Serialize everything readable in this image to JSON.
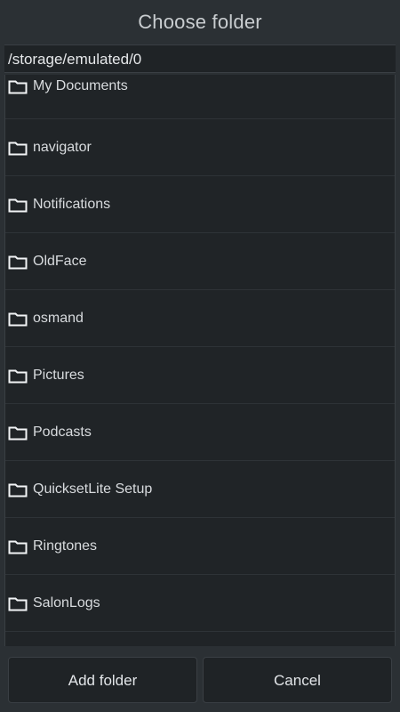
{
  "dialog": {
    "title": "Choose folder",
    "path": "/storage/emulated/0",
    "folders": [
      {
        "name": "My Documents",
        "icon": "folder-icon"
      },
      {
        "name": "navigator",
        "icon": "folder-icon"
      },
      {
        "name": "Notifications",
        "icon": "folder-icon"
      },
      {
        "name": "OldFace",
        "icon": "folder-icon"
      },
      {
        "name": "osmand",
        "icon": "folder-icon"
      },
      {
        "name": "Pictures",
        "icon": "folder-icon"
      },
      {
        "name": "Podcasts",
        "icon": "folder-icon"
      },
      {
        "name": "QuicksetLite Setup",
        "icon": "folder-icon"
      },
      {
        "name": "Ringtones",
        "icon": "folder-icon"
      },
      {
        "name": "SalonLogs",
        "icon": "folder-icon"
      }
    ],
    "buttons": {
      "add_folder": "Add folder",
      "cancel": "Cancel"
    }
  },
  "colors": {
    "background": "#2b3034",
    "list_background": "#202427",
    "text": "#d8dbde",
    "title_text": "#c9cdd0"
  }
}
